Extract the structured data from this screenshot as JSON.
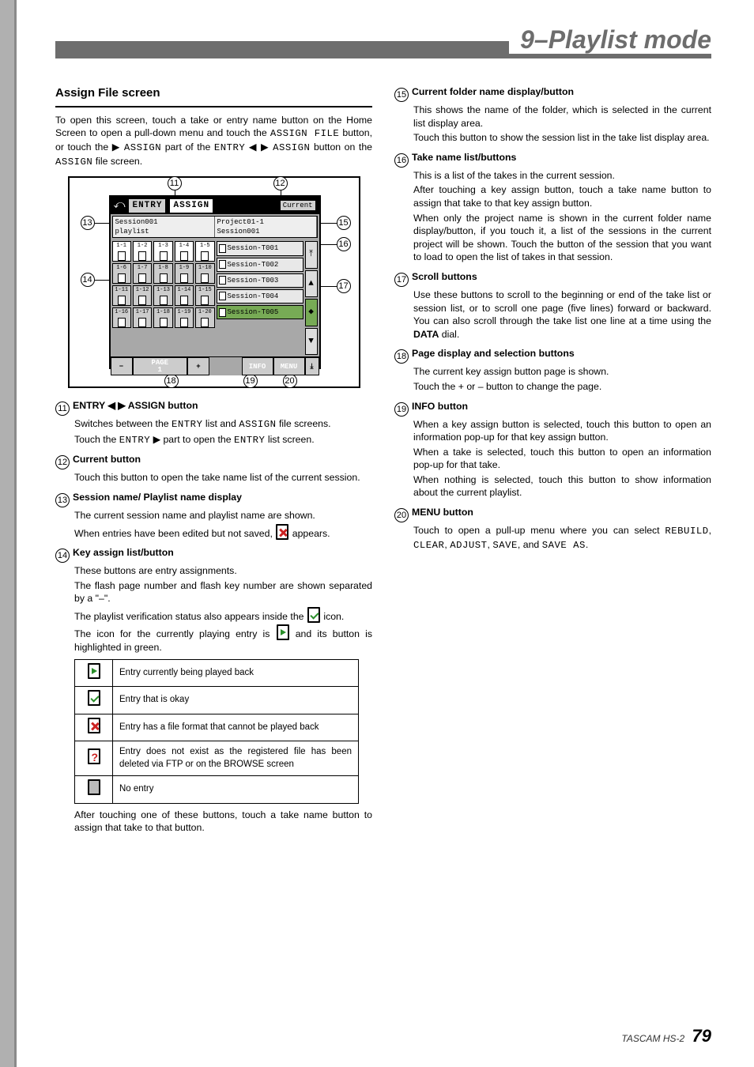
{
  "header": {
    "title": "9–Playlist mode"
  },
  "left": {
    "h3": "Assign File screen",
    "intro1": "To open this screen, touch a take or entry name button on the Home Screen to open a pull-down menu and touch the ",
    "intro_b1": "ASSIGN FILE",
    "intro2": " button, or touch the ",
    "arrow_r": "▶",
    "intro_b2": "ASSIGN",
    "intro3": " part of the ",
    "intro_b3": "ENTRY",
    "arrow_l": "◀",
    "intro_b4": "ASSIGN",
    "intro4": " button on the ",
    "intro_b5": "ASSIGN",
    "intro5": " file screen.",
    "shot": {
      "seg_entry": "ENTRY",
      "seg_assign": "ASSIGN",
      "cur": "Current",
      "path_left_a": "Session001",
      "path_left_b": "playlist",
      "path_right_a": "Project01-1",
      "path_right_b": "Session001",
      "keys": [
        [
          "1-1",
          "1-2",
          "1-3",
          "1-4",
          "1-5"
        ],
        [
          "1-6",
          "1-7",
          "1-8",
          "1-9",
          "1-10"
        ],
        [
          "1-11",
          "1-12",
          "1-13",
          "1-14",
          "1-15"
        ],
        [
          "1-16",
          "1-17",
          "1-18",
          "1-19",
          "1-20"
        ]
      ],
      "takes": [
        "Session-T001",
        "Session-T002",
        "Session-T003",
        "Session-T004",
        "Session-T005"
      ],
      "page_label": "PAGE",
      "page_num": "1",
      "info": "INFO",
      "menu": "MENU"
    },
    "items": {
      "i11_head": "ENTRY ◀ ▶ ASSIGN button",
      "i11_a": "Switches between the ",
      "i11_b": "ENTRY",
      "i11_c": " list and ",
      "i11_d": "ASSIGN",
      "i11_e": " file screens.",
      "i11_f": "Touch the ",
      "i11_g": "ENTRY",
      "i11_h": " ▶ part to open the ",
      "i11_i": "ENTRY",
      "i11_j": " list screen.",
      "i12_head": "Current button",
      "i12_a": "Touch this button to open the take name list of the current session.",
      "i13_head": "Session name/ Playlist name display",
      "i13_a": "The current session name and playlist name are shown.",
      "i13_b": "When entries have been edited but not saved, ",
      "i13_c": " appears.",
      "i14_head": "Key assign list/button",
      "i14_a": "These buttons are entry assignments.",
      "i14_b": "The flash page number and flash key number are shown separated by a \"–\".",
      "i14_c": "The playlist verification status also appears inside the ",
      "i14_d": " icon.",
      "i14_e": "The icon for the currently playing entry is ",
      "i14_f": " and its button is highlighted in green.",
      "legend": [
        "Entry currently being played back",
        "Entry that is okay",
        "Entry has a file format that cannot be played back",
        "Entry does not exist as the registered file has been deleted via FTP or on the BROWSE screen",
        "No entry"
      ],
      "i14_after": "After touching one of these buttons, touch a take name button to assign that take to that button."
    }
  },
  "right": {
    "i15_head": "Current folder name display/button",
    "i15_a": "This shows the name of the folder, which is selected in the current list display area.",
    "i15_b": "Touch this button to show the session list in the take list display area.",
    "i16_head": "Take name list/buttons",
    "i16_a": "This is a list of the takes in the current session.",
    "i16_b": "After touching a key assign button, touch a take name button to assign that take to that key assign button.",
    "i16_c": "When only the project name is shown in the current folder name display/button, if you touch it, a list of the sessions in the current project will be shown. Touch the button of the session that you want to load to open the list of takes in that session.",
    "i17_head": "Scroll buttons",
    "i17_a": "Use these buttons to scroll to the beginning or end of the take list or session list, or to scroll one page (five lines) forward or backward. You can also scroll through the take list one line at a time using the ",
    "i17_b": "DATA",
    "i17_c": " dial.",
    "i18_head": "Page display and selection buttons",
    "i18_a": "The current key assign button page is shown.",
    "i18_b": "Touch the + or – button to change the page.",
    "i19_head": "INFO button",
    "i19_a": "When a key assign button is selected, touch this button to open an information pop-up for that key assign button.",
    "i19_b": "When a take is selected, touch this button to open an information pop-up for that take.",
    "i19_c": "When nothing is selected, touch this button to show information about the current playlist.",
    "i20_head": "MENU button",
    "i20_a": "Touch to open a pull-up menu where you can select ",
    "i20_b": "REBUILD",
    "i20_c": "CLEAR",
    "i20_d": "ADJUST",
    "i20_e": "SAVE",
    "i20_f": ", and ",
    "i20_g": "SAVE AS",
    "i20_h": "."
  },
  "footer": {
    "brand": "TASCAM HS-2",
    "page": "79"
  },
  "callouts": {
    "n11": "11",
    "n12": "12",
    "n13": "13",
    "n14": "14",
    "n15": "15",
    "n16": "16",
    "n17": "17",
    "n18": "18",
    "n19": "19",
    "n20": "20"
  }
}
